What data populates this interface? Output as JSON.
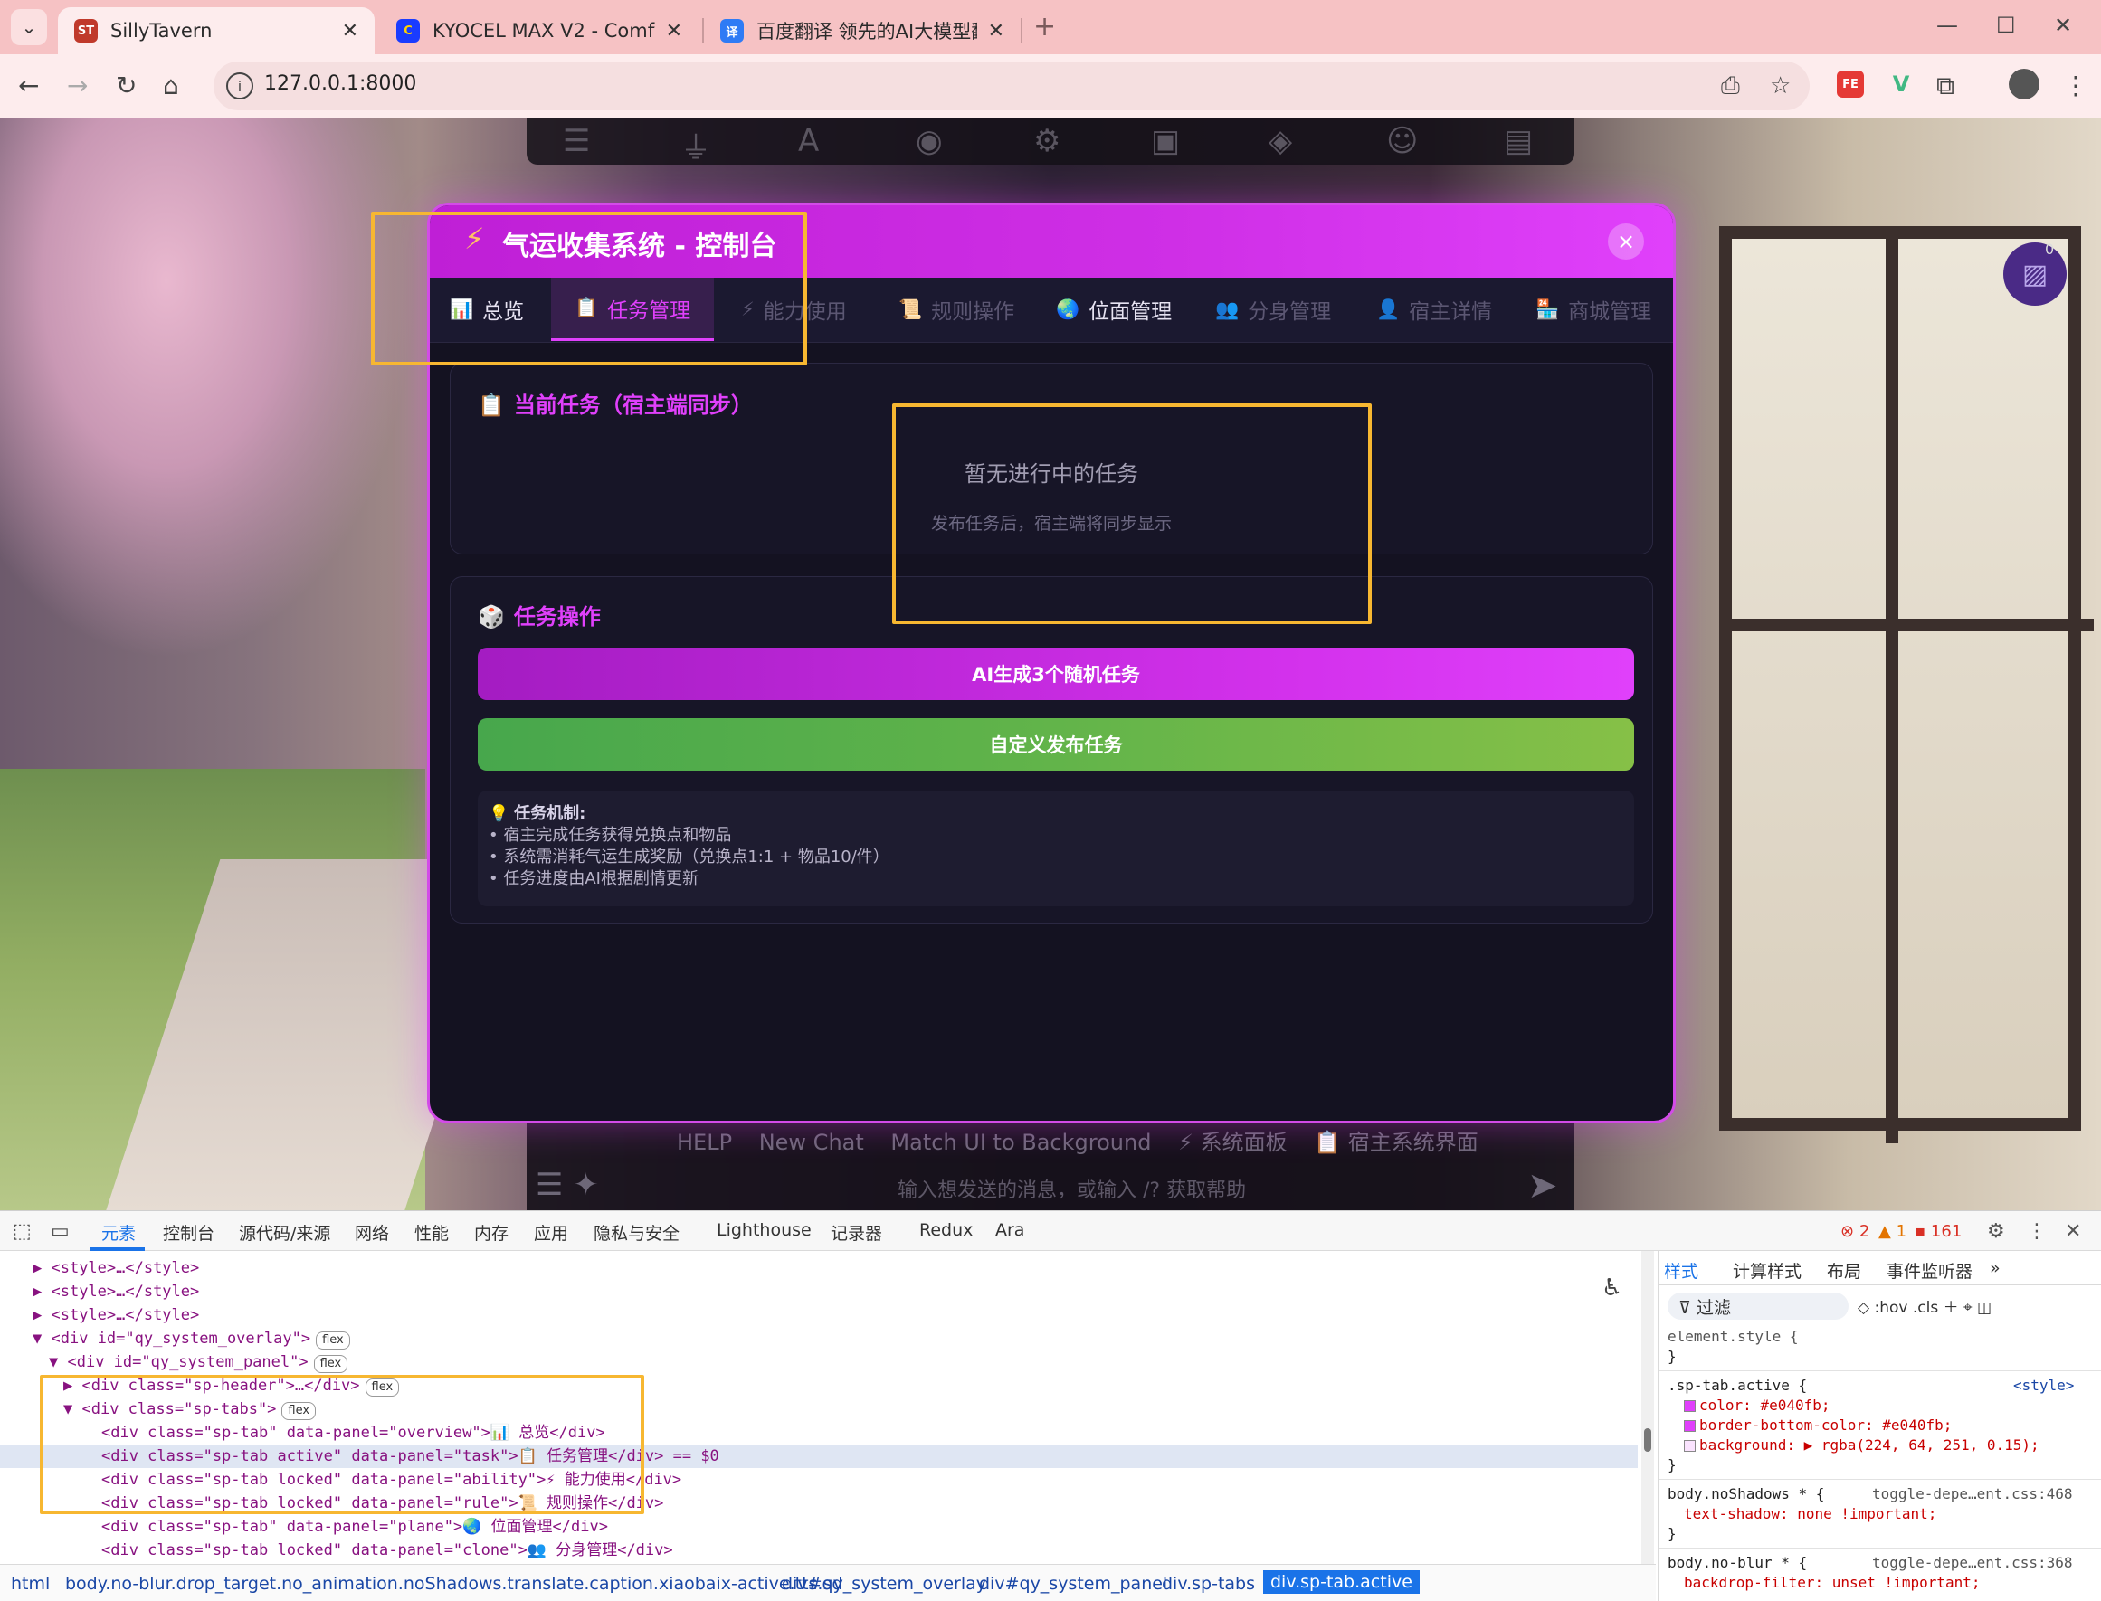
{
  "browser": {
    "tabs": [
      {
        "title": "SillyTavern",
        "favicon": "ST",
        "active": true
      },
      {
        "title": "KYOCEL MAX  V2 - ComfyUI",
        "favicon": "C",
        "active": false
      },
      {
        "title": "百度翻译 领先的AI大模型翻译",
        "favicon": "译",
        "active": false
      }
    ],
    "url": "127.0.0.1:8000",
    "extensions": [
      "FE",
      "V"
    ]
  },
  "background": {
    "bottom_links": [
      "HELP",
      "New Chat",
      "Match UI to Background",
      "⚡ 系统面板",
      "📋 宿主系统界面"
    ],
    "input_placeholder": "输入想发送的消息，或输入 /? 获取帮助",
    "float_badge": "0"
  },
  "panel": {
    "title": "气运收集系统 - 控制台",
    "title_icon": "lightning-icon",
    "close_label": "×",
    "tabs": [
      {
        "icon": "📊",
        "label": "总览",
        "state": "normal"
      },
      {
        "icon": "📋",
        "label": "任务管理",
        "state": "active"
      },
      {
        "icon": "⚡",
        "label": "能力使用",
        "state": "locked"
      },
      {
        "icon": "📜",
        "label": "规则操作",
        "state": "locked"
      },
      {
        "icon": "🌏",
        "label": "位面管理",
        "state": "normal"
      },
      {
        "icon": "👥",
        "label": "分身管理",
        "state": "locked"
      },
      {
        "icon": "👤",
        "label": "宿主详情",
        "state": "locked"
      },
      {
        "icon": "🏪",
        "label": "商城管理",
        "state": "locked"
      }
    ],
    "current_task": {
      "icon": "📋",
      "title": "当前任务（宿主端同步）",
      "empty_main": "暂无进行中的任务",
      "empty_sub": "发布任务后，宿主端将同步显示"
    },
    "task_ops": {
      "icon": "🎲",
      "title": "任务操作",
      "ai_button": "AI生成3个随机任务",
      "custom_button": "自定义发布任务",
      "tips_icon": "💡",
      "tips_title": "任务机制",
      "tips": [
        "• 宿主完成任务获得兑换点和物品",
        "• 系统需消耗气运生成奖励（兑换点1:1 + 物品10/件）",
        "• 任务进度由AI根据剧情更新"
      ]
    }
  },
  "devtools": {
    "tabs": [
      "元素",
      "控制台",
      "源代码/来源",
      "网络",
      "性能",
      "内存",
      "应用",
      "隐私与安全",
      "Lighthouse",
      "记录器",
      "Redux",
      "Ara"
    ],
    "active_tab": "元素",
    "errors": "2",
    "warnings": "1",
    "issues": "161",
    "elements_lines": [
      {
        "indent": 1,
        "text": "<style>…</style>"
      },
      {
        "indent": 1,
        "text": "<style>…</style>"
      },
      {
        "indent": 1,
        "text": "<style>…</style>"
      },
      {
        "indent": 1,
        "text": "<div id=\"qy_system_overlay\">",
        "badge": "flex"
      },
      {
        "indent": 2,
        "text": "<div id=\"qy_system_panel\">",
        "badge": "flex"
      },
      {
        "indent": 3,
        "text": "<div class=\"sp-header\">…</div>",
        "badge": "flex"
      },
      {
        "indent": 3,
        "text": "<div class=\"sp-tabs\">",
        "badge": "flex"
      },
      {
        "indent": 4,
        "text": "<div class=\"sp-tab\" data-panel=\"overview\">📊 总览</div>"
      },
      {
        "indent": 4,
        "text": "<div class=\"sp-tab active\" data-panel=\"task\">📋 任务管理</div> == $0",
        "selected": true
      },
      {
        "indent": 4,
        "text": "<div class=\"sp-tab locked\" data-panel=\"ability\">⚡ 能力使用</div>"
      },
      {
        "indent": 4,
        "text": "<div class=\"sp-tab locked\" data-panel=\"rule\">📜 规则操作</div>"
      },
      {
        "indent": 4,
        "text": "<div class=\"sp-tab\" data-panel=\"plane\">🌏 位面管理</div>"
      },
      {
        "indent": 4,
        "text": "<div class=\"sp-tab locked\" data-panel=\"clone\">👥 分身管理</div>"
      }
    ],
    "styles_tabs": [
      "样式",
      "计算样式",
      "布局",
      "事件监听器"
    ],
    "filter_label": "过滤",
    "styles_tools": ":hov  .cls",
    "styles_rules": [
      {
        "selector": "element.style {",
        "lines": [
          "}"
        ]
      },
      {
        "selector": ".sp-tab.active {",
        "source": "<style>",
        "lines": [
          "color: #e040fb;",
          "border-bottom-color: #e040fb;",
          "background: ▶ rgba(224, 64, 251, 0.15);",
          "}"
        ]
      },
      {
        "selector": "body.noShadows * {",
        "source": "toggle-depe…ent.css:468",
        "lines": [
          "text-shadow: none !important;",
          "}"
        ]
      },
      {
        "selector": "body.no-blur * {",
        "source": "toggle-depe…ent.css:368",
        "lines": [
          "backdrop-filter: unset !important;"
        ]
      }
    ],
    "breadcrumb": [
      "html",
      "body.no-blur.drop_target.no_animation.noShadows.translate.caption.xiaobaix-active.tts.sd",
      "div#qy_system_overlay",
      "div#qy_system_panel",
      "div.sp-tabs",
      "div.sp-tab.active"
    ],
    "colors": {
      "accent": "#e040fb",
      "link": "#1a73e8"
    }
  }
}
